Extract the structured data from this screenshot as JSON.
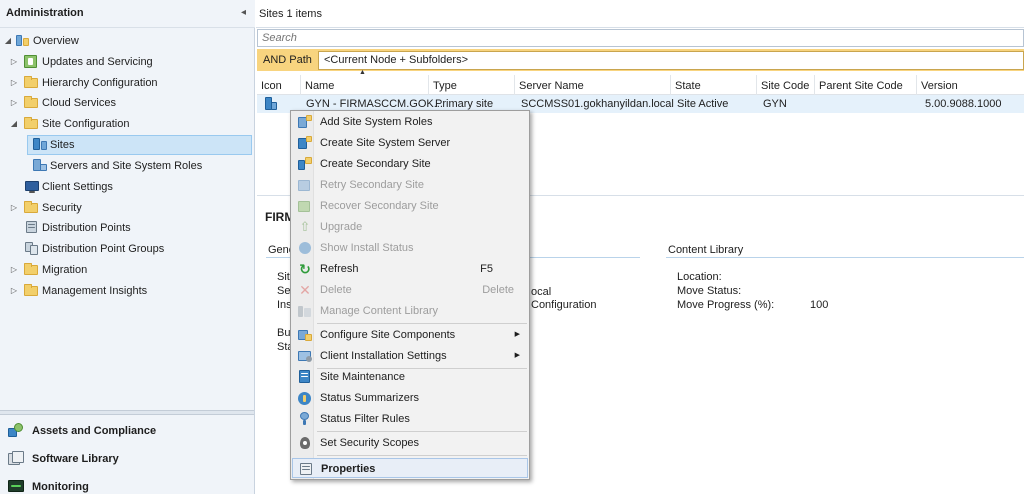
{
  "nav": {
    "title": "Administration",
    "collapse_glyph": "◂",
    "tree": [
      {
        "label": "Overview",
        "icon": "overview-icon",
        "expander": "◢"
      },
      {
        "label": "Updates and Servicing",
        "icon": "updates-icon",
        "expander": "▷"
      },
      {
        "label": "Hierarchy Configuration",
        "icon": "folder-icon",
        "expander": "▷"
      },
      {
        "label": "Cloud Services",
        "icon": "folder-icon",
        "expander": "▷"
      },
      {
        "label": "Site Configuration",
        "icon": "folder-icon",
        "expander": "◢"
      },
      {
        "label": "Sites",
        "icon": "sites-icon",
        "expander": ""
      },
      {
        "label": "Servers and Site System Roles",
        "icon": "servers-icon",
        "expander": ""
      },
      {
        "label": "Client Settings",
        "icon": "client-settings-icon",
        "expander": ""
      },
      {
        "label": "Security",
        "icon": "folder-icon",
        "expander": "▷"
      },
      {
        "label": "Distribution Points",
        "icon": "distribution-points-icon",
        "expander": ""
      },
      {
        "label": "Distribution Point Groups",
        "icon": "distribution-point-groups-icon",
        "expander": ""
      },
      {
        "label": "Migration",
        "icon": "folder-icon",
        "expander": "▷"
      },
      {
        "label": "Management Insights",
        "icon": "folder-icon",
        "expander": "▷"
      }
    ],
    "workspaces": [
      {
        "label": "Assets and Compliance",
        "icon": "assets-icon"
      },
      {
        "label": "Software Library",
        "icon": "software-library-icon"
      },
      {
        "label": "Monitoring",
        "icon": "monitoring-icon"
      }
    ]
  },
  "main": {
    "title": "Sites 1 items",
    "search_placeholder": "Search",
    "filter_label": "AND Path",
    "filter_value": "<Current Node + Subfolders>",
    "columns": [
      "Icon",
      "Name",
      "Type",
      "Server Name",
      "State",
      "Site Code",
      "Parent Site Code",
      "Version"
    ],
    "row": {
      "name": "GYN - FIRMASCCM.GOK...",
      "type": "Primary site",
      "server": "SCCMSS01.gokhanyildan.local",
      "state": "Site Active",
      "site_code": "GYN",
      "parent_site_code": "",
      "version": "5.00.9088.1000"
    }
  },
  "details": {
    "title_fragment": "FIRM",
    "general_fragment": "Gene",
    "left_fragments": [
      "Sit",
      "Se",
      "Ins",
      "Bu",
      "Sta"
    ],
    "mid_fragments": [
      "ocal",
      " Configuration"
    ],
    "content_library": {
      "heading": "Content Library",
      "labels": [
        "Location:",
        "Move Status:",
        "Move Progress (%):"
      ],
      "move_progress": "100"
    }
  },
  "context_menu": {
    "items": [
      {
        "label": "Add Site System Roles",
        "icon": "add-roles-icon",
        "enabled": true,
        "shortcut": ""
      },
      {
        "label": "Create Site System Server",
        "icon": "create-server-icon",
        "enabled": true,
        "shortcut": ""
      },
      {
        "label": "Create Secondary Site",
        "icon": "create-secondary-icon",
        "enabled": true,
        "shortcut": ""
      },
      {
        "label": "Retry Secondary Site",
        "icon": "retry-icon",
        "enabled": false,
        "shortcut": ""
      },
      {
        "label": "Recover Secondary Site",
        "icon": "recover-icon",
        "enabled": false,
        "shortcut": ""
      },
      {
        "label": "Upgrade",
        "icon": "upgrade-icon",
        "enabled": false,
        "shortcut": ""
      },
      {
        "label": "Show Install Status",
        "icon": "install-status-icon",
        "enabled": false,
        "shortcut": ""
      },
      {
        "label": "Refresh",
        "icon": "refresh-icon",
        "enabled": true,
        "shortcut": "F5"
      },
      {
        "label": "Delete",
        "icon": "delete-icon",
        "enabled": false,
        "shortcut": "Delete"
      },
      {
        "label": "Manage Content Library",
        "icon": "content-library-icon",
        "enabled": false,
        "shortcut": ""
      },
      {
        "label": "Configure Site Components",
        "icon": "configure-components-icon",
        "enabled": true,
        "submenu": true
      },
      {
        "label": "Client Installation Settings",
        "icon": "client-install-icon",
        "enabled": true,
        "submenu": true
      },
      {
        "label": "Site Maintenance",
        "icon": "maintenance-icon",
        "enabled": true,
        "shortcut": ""
      },
      {
        "label": "Status Summarizers",
        "icon": "status-summarizers-icon",
        "enabled": true,
        "shortcut": ""
      },
      {
        "label": "Status Filter Rules",
        "icon": "status-filter-icon",
        "enabled": true,
        "shortcut": ""
      },
      {
        "label": "Set Security Scopes",
        "icon": "security-scopes-icon",
        "enabled": true,
        "shortcut": ""
      },
      {
        "label": "Properties",
        "icon": "properties-icon",
        "enabled": true,
        "shortcut": ""
      }
    ],
    "submenu_glyph": "▶"
  },
  "colors": {
    "accent": "#0078d7",
    "selection": "#cce4f7",
    "filter_bar": "#f8d47f",
    "disabled_text": "#9d9d9d"
  }
}
